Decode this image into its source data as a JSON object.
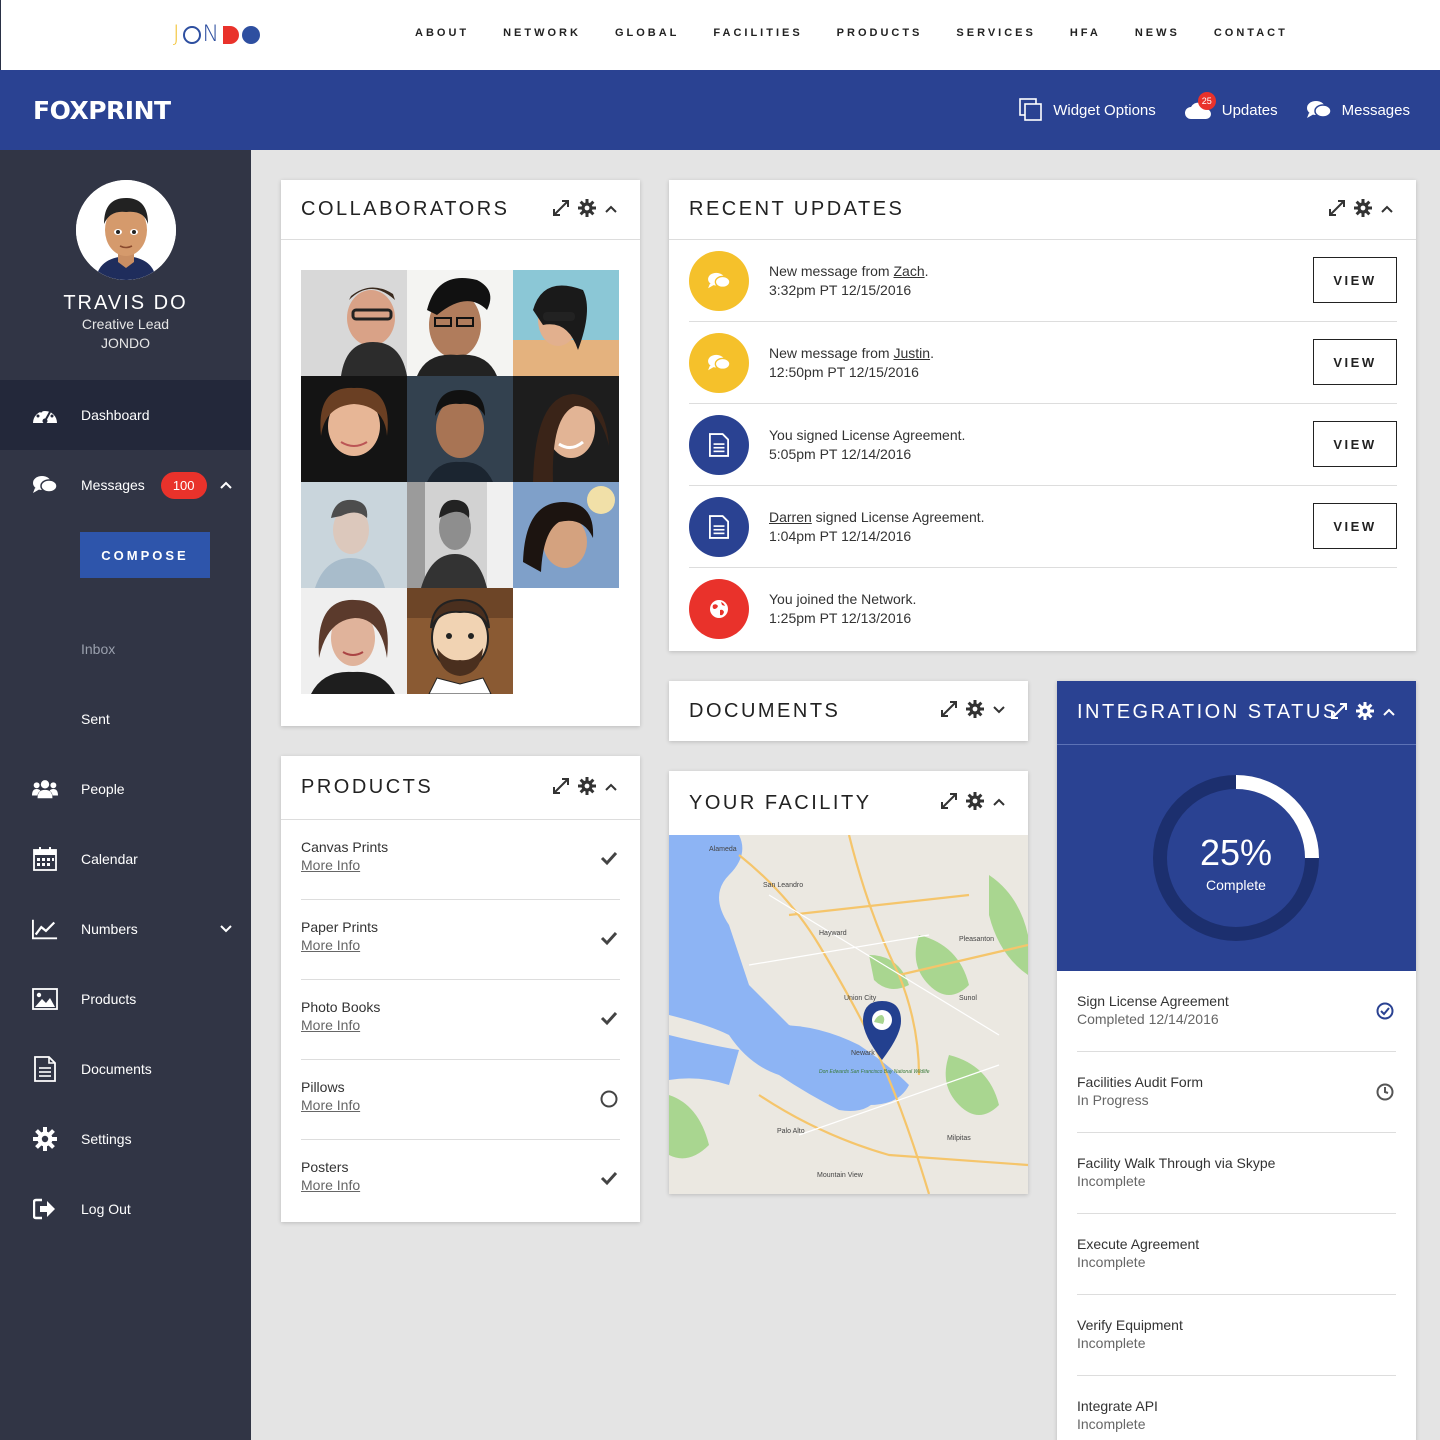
{
  "topnav": {
    "logo": "JONDO",
    "links": [
      "ABOUT",
      "NETWORK",
      "GLOBAL",
      "FACILITIES",
      "PRODUCTS",
      "SERVICES",
      "HFA",
      "NEWS",
      "CONTACT"
    ]
  },
  "header": {
    "logo": "FOXPRINT",
    "widget_options": "Widget Options",
    "updates": "Updates",
    "updates_badge": "25",
    "messages": "Messages"
  },
  "profile": {
    "name": "TRAVIS DO",
    "role": "Creative Lead",
    "company": "JONDO"
  },
  "sidebar": {
    "dashboard": "Dashboard",
    "messages": "Messages",
    "messages_badge": "100",
    "compose": "COMPOSE",
    "inbox": "Inbox",
    "sent": "Sent",
    "people": "People",
    "calendar": "Calendar",
    "numbers": "Numbers",
    "products": "Products",
    "documents": "Documents",
    "settings": "Settings",
    "logout": "Log Out"
  },
  "collaborators": {
    "title": "COLLABORATORS"
  },
  "products": {
    "title": "PRODUCTS",
    "more_info": "More Info",
    "items": [
      {
        "name": "Canvas Prints",
        "status": "check"
      },
      {
        "name": "Paper Prints",
        "status": "check"
      },
      {
        "name": "Photo Books",
        "status": "check"
      },
      {
        "name": "Pillows",
        "status": "circle"
      },
      {
        "name": "Posters",
        "status": "check"
      }
    ]
  },
  "updates": {
    "title": "RECENT UPDATES",
    "view": "VIEW",
    "items": [
      {
        "pre": "New message from ",
        "link": "Zach",
        "post": ".",
        "time": "3:32pm PT 12/15/2016",
        "icon": "chat-icon",
        "color": "#f5c12b"
      },
      {
        "pre": "New message from ",
        "link": "Justin",
        "post": ".",
        "time": "12:50pm PT 12/15/2016",
        "icon": "chat-icon",
        "color": "#f5c12b"
      },
      {
        "pre": "You signed License Agreement.",
        "link": "",
        "post": "",
        "time": "5:05pm PT 12/14/2016",
        "icon": "document-icon",
        "color": "#2a4292"
      },
      {
        "pre": "",
        "link": "Darren",
        "post": " signed License Agreement.",
        "time": "1:04pm PT 12/14/2016",
        "icon": "document-icon",
        "color": "#2a4292"
      },
      {
        "pre": "You joined the Network.",
        "link": "",
        "post": "",
        "time": "1:25pm PT 12/13/2016",
        "icon": "globe-icon",
        "color": "#e9322b"
      }
    ]
  },
  "documents": {
    "title": "DOCUMENTS"
  },
  "facility": {
    "title": "YOUR FACILITY",
    "map_labels": [
      "Alameda",
      "San Leandro",
      "Hayward",
      "Pleasanton",
      "Union City",
      "Newark",
      "Palo Alto",
      "Mountain View",
      "Milpitas",
      "Sunol",
      "Don Edwards San Francisco Bay National Wildlife"
    ]
  },
  "integration": {
    "title": "INTEGRATION STATUS",
    "percent": "25%",
    "progress": 0.25,
    "complete_label": "Complete",
    "items": [
      {
        "name": "Sign License Agreement",
        "status": "Completed 12/14/2016",
        "icon": "check-circle-icon"
      },
      {
        "name": "Facilities Audit Form",
        "status": "In Progress",
        "icon": "clock-icon"
      },
      {
        "name": "Facility Walk Through via Skype",
        "status": "Incomplete",
        "icon": ""
      },
      {
        "name": "Execute Agreement",
        "status": "Incomplete",
        "icon": ""
      },
      {
        "name": "Verify Equipment",
        "status": "Incomplete",
        "icon": ""
      },
      {
        "name": "Integrate API",
        "status": "Incomplete",
        "icon": ""
      }
    ]
  },
  "colors": {
    "brand_blue": "#2a4292",
    "sidebar_bg": "#313545",
    "accent_red": "#e9322b",
    "accent_yellow": "#f5c12b"
  }
}
